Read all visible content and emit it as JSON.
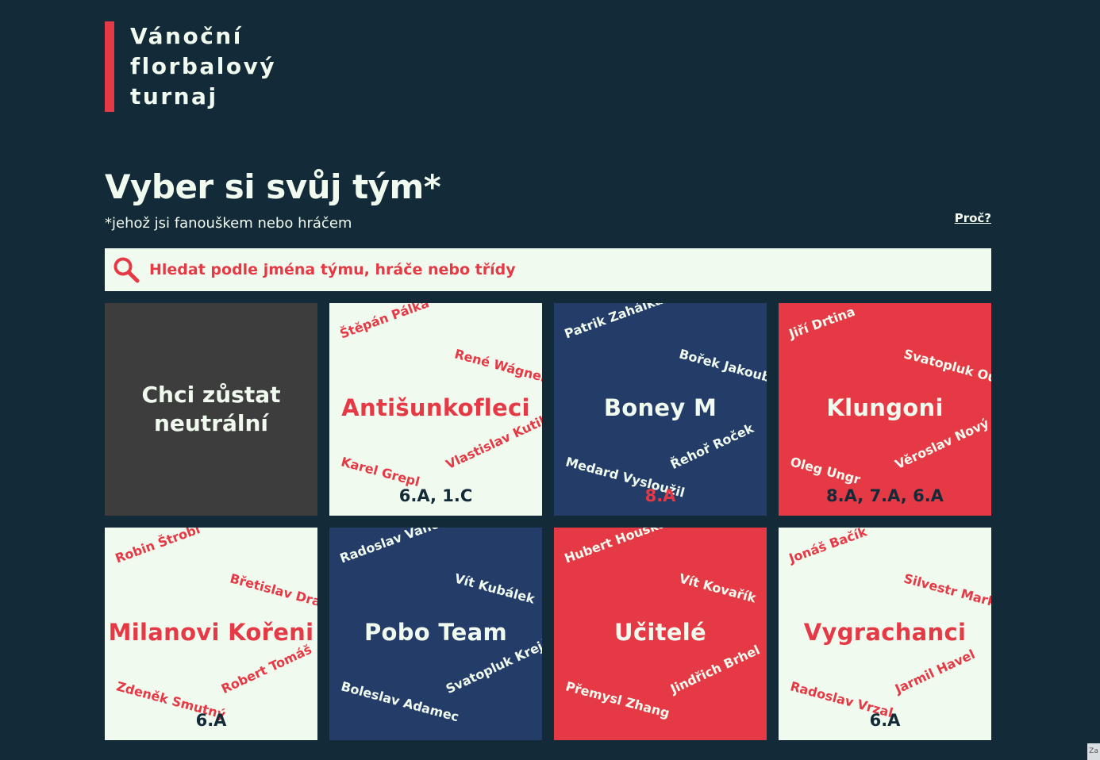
{
  "logo": {
    "lines": [
      "Vánoční",
      "florbalový",
      "turnaj"
    ]
  },
  "headline": "Vyber si svůj tým*",
  "subline": "*jehož jsi fanouškem nebo hráčem",
  "why_link": "Proč?",
  "search": {
    "icon": "magnifier-icon",
    "placeholder": "Hledat podle jména týmu, hráče nebo třídy"
  },
  "neutral": {
    "label": "Chci zůstat neutrální"
  },
  "teams": [
    {
      "name": "Antišunkofleci",
      "theme": "light",
      "players": [
        "Štěpán Pálka",
        "René Wágner",
        "Karel Grepl",
        "Vlastislav Kutil"
      ],
      "classes": "6.A, 1.C"
    },
    {
      "name": "Boney M",
      "theme": "blue",
      "players": [
        "Patrik Zahálka",
        "Bořek Jakoubek",
        "Medard Vysloužil",
        "Řehoř Roček"
      ],
      "classes": "8.A"
    },
    {
      "name": "Klungoni",
      "theme": "red",
      "players": [
        "Jiří Drtina",
        "Svatopluk Oulehla",
        "Oleg Ungr",
        "Věroslav Nový"
      ],
      "classes": "8.A, 7.A, 6.A"
    },
    {
      "name": "Milanovi Kořeni",
      "theme": "light",
      "players": [
        "Robin Štrobl",
        "Břetislav Drahoš",
        "Zdeněk Smutný",
        "Robert Tomáš"
      ],
      "classes": "6.A"
    },
    {
      "name": "Pobo Team",
      "theme": "blue",
      "players": [
        "Radoslav Vančura",
        "Vít Kubálek",
        "Boleslav Adamec",
        "Svatopluk Krejčíř"
      ],
      "classes": ""
    },
    {
      "name": "Učitelé",
      "theme": "red",
      "players": [
        "Hubert Houška",
        "Vít Kovařík",
        "Přemysl Zhang",
        "Jindřich Brhel"
      ],
      "classes": ""
    },
    {
      "name": "Vygrachanci",
      "theme": "light",
      "players": [
        "Jonáš Bačík",
        "Silvestr Markvart",
        "Radoslav Vrzal",
        "Jarmil Havel"
      ],
      "classes": "6.A"
    }
  ],
  "colors": {
    "background": "#132b38",
    "accent_red": "#e63946",
    "light": "#f1faee",
    "blue": "#233d68",
    "neutral_gray": "#3d3d3d"
  },
  "corner_label": "Za"
}
